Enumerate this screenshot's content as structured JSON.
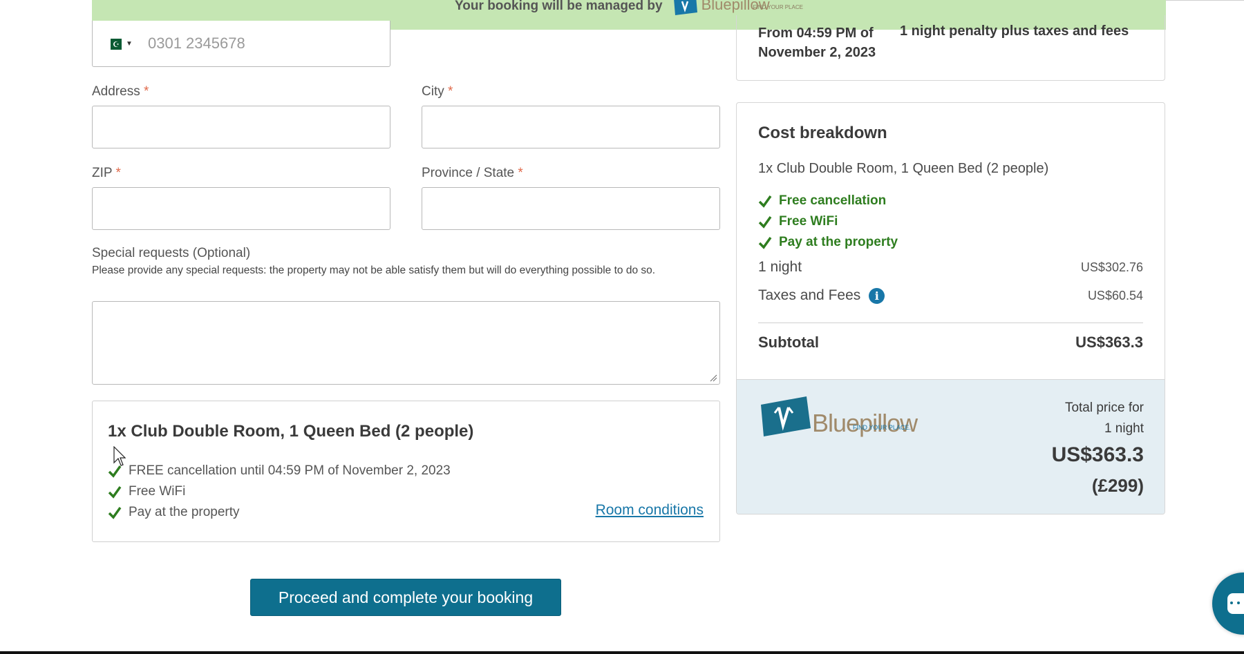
{
  "banner": {
    "text": "Your booking will be managed by",
    "logo_word": "Bluepillow",
    "logo_tag": "FIND YOUR PLACE"
  },
  "form": {
    "phone": {
      "placeholder": "0301 2345678",
      "country_flag": "PK"
    },
    "address": {
      "label": "Address",
      "required_mark": "*",
      "value": ""
    },
    "city": {
      "label": "City",
      "required_mark": "*",
      "value": ""
    },
    "zip": {
      "label": "ZIP",
      "required_mark": "*",
      "value": ""
    },
    "province": {
      "label": "Province / State",
      "required_mark": "*",
      "value": ""
    },
    "special_requests": {
      "label": "Special requests (Optional)",
      "note": "Please provide any special requests: the property may not be able satisfy them but will do everything possible to do so.",
      "value": ""
    }
  },
  "room_summary": {
    "title": "1x Club Double Room, 1 Queen Bed (2 people)",
    "features": [
      "FREE cancellation until 04:59 PM of November 2, 2023",
      "Free WiFi",
      "Pay at the property"
    ],
    "conditions_link": "Room conditions"
  },
  "proceed_button": "Proceed and complete your booking",
  "policy": {
    "line1": "From 04:59 PM of",
    "line2": "November 2, 2023",
    "penalty": "1 night penalty plus taxes and fees"
  },
  "cost": {
    "title": "Cost breakdown",
    "room": "1x Club Double Room, 1 Queen Bed (2 people)",
    "perks": [
      "Free cancellation",
      "Free WiFi",
      "Pay at the property"
    ],
    "night_label": "1 night",
    "night_value": "US$302.76",
    "taxes_label": "Taxes and Fees",
    "taxes_value": "US$60.54",
    "subtotal_label": "Subtotal",
    "subtotal_value": "US$363.3",
    "total_label_1": "Total price for",
    "total_label_2": "1 night",
    "total_value": "US$363.3",
    "total_gbp": "(£299)",
    "logo_word": "Bluepillow",
    "logo_tag": "FIND YOUR PLACE."
  },
  "colors": {
    "accent": "#0e6f8e",
    "banner": "#c5e6b3",
    "perk_green": "#2e7d1f",
    "link": "#1877a8",
    "total_panel": "#e4eef3"
  }
}
